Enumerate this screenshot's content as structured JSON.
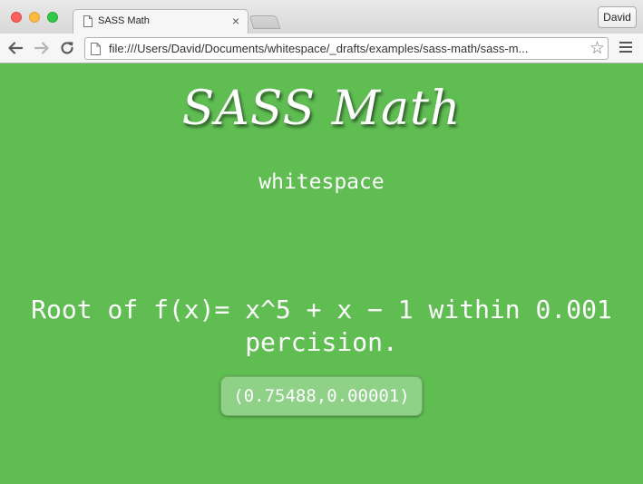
{
  "browser": {
    "tab_title": "SASS Math",
    "profile_name": "David",
    "url": "file:///Users/David/Documents/whitespace/_drafts/examples/sass-math/sass-m..."
  },
  "page": {
    "heading": "SASS Math",
    "subtitle": "whitespace",
    "problem_line1": "Root of f(x)= x^5 + x − 1 within 0.001",
    "problem_line2": "percision.",
    "result": "(0.75488,0.00001)"
  },
  "colors": {
    "page_background": "#5fbd52",
    "text": "#ffffff"
  }
}
